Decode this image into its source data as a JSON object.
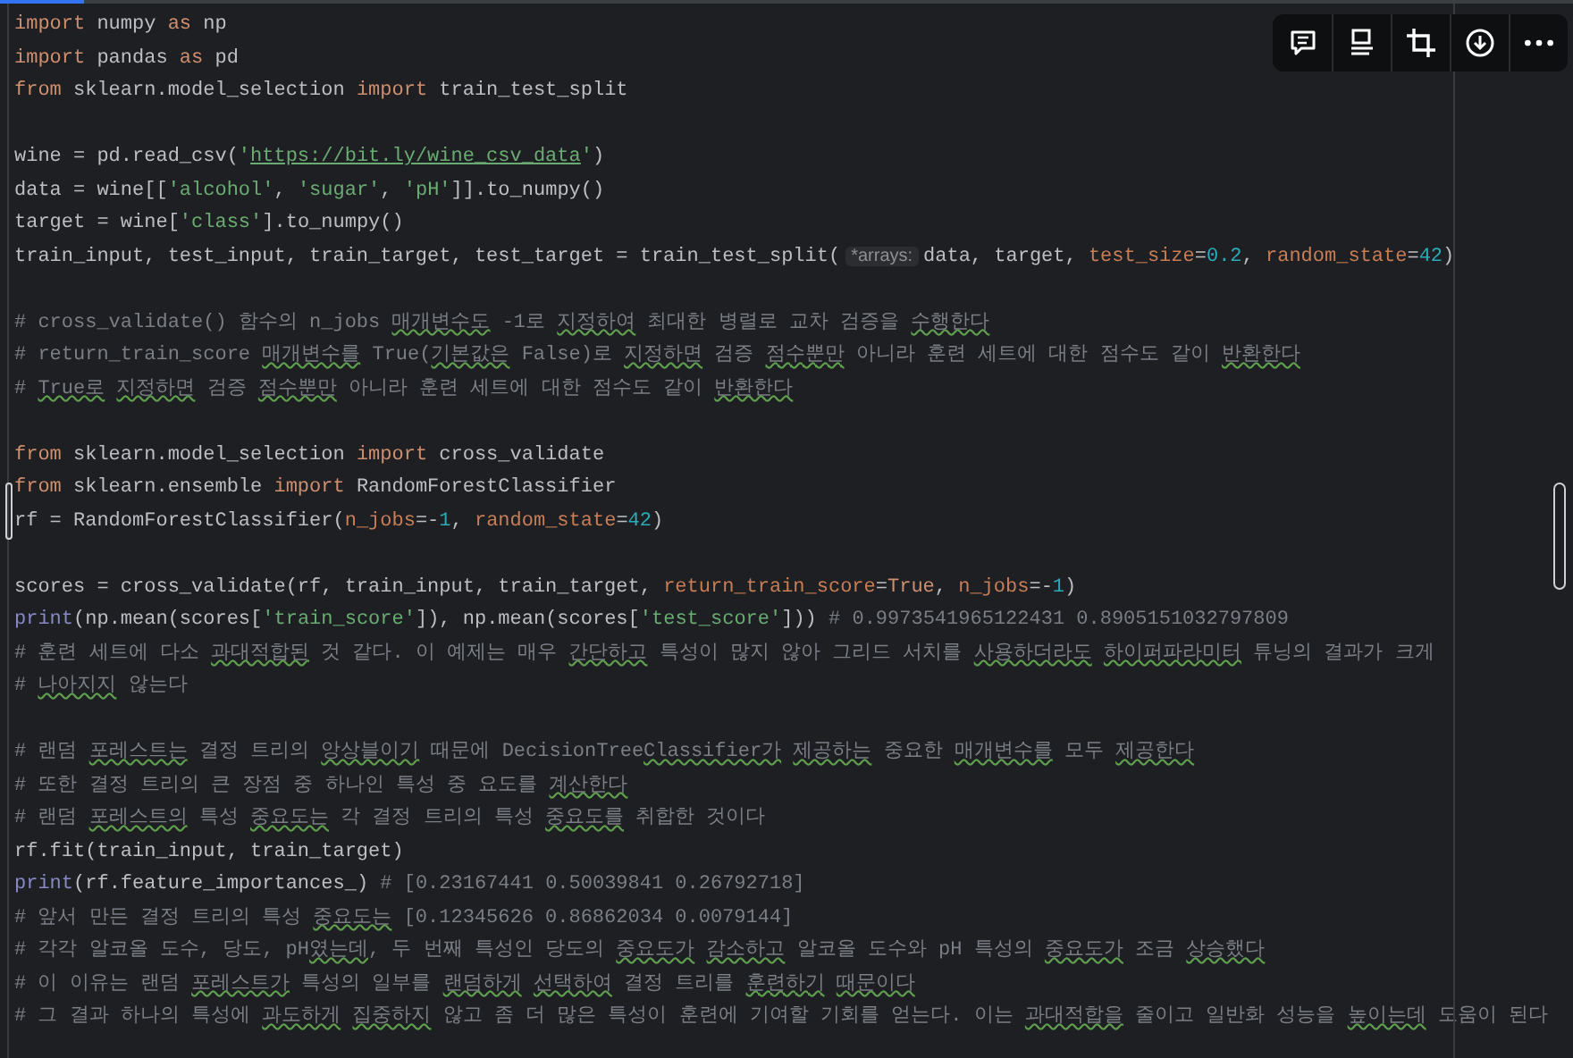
{
  "toolbar": {
    "buttons": [
      {
        "kind": "comment"
      },
      {
        "kind": "layout"
      },
      {
        "kind": "crop"
      },
      {
        "kind": "download"
      },
      {
        "kind": "more"
      }
    ]
  },
  "editor": {
    "lines": [
      {
        "kind": "code",
        "tokens": [
          {
            "kind": "kw",
            "text": "import"
          },
          {
            "kind": "plain",
            "text": " numpy "
          },
          {
            "kind": "kw",
            "text": "as"
          },
          {
            "kind": "plain",
            "text": " np"
          }
        ]
      },
      {
        "kind": "code",
        "tokens": [
          {
            "kind": "kw",
            "text": "import"
          },
          {
            "kind": "plain",
            "text": " pandas "
          },
          {
            "kind": "kw",
            "text": "as"
          },
          {
            "kind": "plain",
            "text": " pd"
          }
        ]
      },
      {
        "kind": "code",
        "tokens": [
          {
            "kind": "kw",
            "text": "from"
          },
          {
            "kind": "plain",
            "text": " sklearn.model_selection "
          },
          {
            "kind": "kw",
            "text": "import"
          },
          {
            "kind": "plain",
            "text": " train_test_split"
          }
        ]
      },
      {
        "kind": "blank"
      },
      {
        "kind": "code",
        "tokens": [
          {
            "kind": "plain",
            "text": "wine = pd.read_csv("
          },
          {
            "kind": "str",
            "text": "'"
          },
          {
            "kind": "link",
            "text": "https://bit.ly/wine_csv_data"
          },
          {
            "kind": "str",
            "text": "'"
          },
          {
            "kind": "plain",
            "text": ")"
          }
        ]
      },
      {
        "kind": "code",
        "tokens": [
          {
            "kind": "plain",
            "text": "data = wine[["
          },
          {
            "kind": "str",
            "text": "'alcohol'"
          },
          {
            "kind": "plain",
            "text": ", "
          },
          {
            "kind": "str",
            "text": "'sugar'"
          },
          {
            "kind": "plain",
            "text": ", "
          },
          {
            "kind": "str",
            "text": "'pH'"
          },
          {
            "kind": "plain",
            "text": "]].to_numpy()"
          }
        ]
      },
      {
        "kind": "code",
        "tokens": [
          {
            "kind": "plain",
            "text": "target = wine["
          },
          {
            "kind": "str",
            "text": "'class'"
          },
          {
            "kind": "plain",
            "text": "].to_numpy()"
          }
        ]
      },
      {
        "kind": "code",
        "tokens": [
          {
            "kind": "plain",
            "text": "train_input, test_input, train_target, test_target = train_test_split("
          },
          {
            "kind": "hint",
            "text": "*arrays:"
          },
          {
            "kind": "plain",
            "text": "data, target, "
          },
          {
            "kind": "param",
            "text": "test_size"
          },
          {
            "kind": "plain",
            "text": "="
          },
          {
            "kind": "num",
            "text": "0.2"
          },
          {
            "kind": "plain",
            "text": ", "
          },
          {
            "kind": "param",
            "text": "random_state"
          },
          {
            "kind": "plain",
            "text": "="
          },
          {
            "kind": "num",
            "text": "42"
          },
          {
            "kind": "plain",
            "text": ")"
          }
        ]
      },
      {
        "kind": "blank"
      },
      {
        "kind": "code",
        "tokens": [
          {
            "kind": "comment",
            "text": "# cross_validate() 함수의 n_jobs "
          },
          {
            "kind": "typo",
            "text": "매개변수도"
          },
          {
            "kind": "comment",
            "text": " -1로 "
          },
          {
            "kind": "typo",
            "text": "지정하여"
          },
          {
            "kind": "comment",
            "text": " 최대한 병렬로 교차 검증을 "
          },
          {
            "kind": "typo",
            "text": "수행한다"
          }
        ]
      },
      {
        "kind": "code",
        "tokens": [
          {
            "kind": "comment",
            "text": "# return_train_score "
          },
          {
            "kind": "typo",
            "text": "매개변수를"
          },
          {
            "kind": "comment",
            "text": " True("
          },
          {
            "kind": "typo",
            "text": "기본값은"
          },
          {
            "kind": "comment",
            "text": " False)로 "
          },
          {
            "kind": "typo",
            "text": "지정하면"
          },
          {
            "kind": "comment",
            "text": " 검증 "
          },
          {
            "kind": "typo",
            "text": "점수뿐만"
          },
          {
            "kind": "comment",
            "text": " 아니라 훈련 세트에 대한 점수도 같이 "
          },
          {
            "kind": "typo",
            "text": "반환한다"
          }
        ]
      },
      {
        "kind": "code",
        "tokens": [
          {
            "kind": "comment",
            "text": "# "
          },
          {
            "kind": "typo",
            "text": "True로",
            "space_after": true
          },
          {
            "kind": "typo",
            "text": "지정하면"
          },
          {
            "kind": "comment",
            "text": " 검증 "
          },
          {
            "kind": "typo",
            "text": "점수뿐만"
          },
          {
            "kind": "comment",
            "text": " 아니라 훈련 세트에 대한 점수도 같이 "
          },
          {
            "kind": "typo",
            "text": "반환한다"
          }
        ]
      },
      {
        "kind": "blank"
      },
      {
        "kind": "code",
        "tokens": [
          {
            "kind": "kw",
            "text": "from"
          },
          {
            "kind": "plain",
            "text": " sklearn.model_selection "
          },
          {
            "kind": "kw",
            "text": "import"
          },
          {
            "kind": "plain",
            "text": " cross_validate"
          }
        ]
      },
      {
        "kind": "code",
        "tokens": [
          {
            "kind": "kw",
            "text": "from"
          },
          {
            "kind": "plain",
            "text": " sklearn.ensemble "
          },
          {
            "kind": "kw",
            "text": "import"
          },
          {
            "kind": "plain",
            "text": " RandomForestClassifier"
          }
        ]
      },
      {
        "kind": "code",
        "tokens": [
          {
            "kind": "plain",
            "text": "rf = RandomForestClassifier("
          },
          {
            "kind": "param",
            "text": "n_jobs"
          },
          {
            "kind": "plain",
            "text": "=-"
          },
          {
            "kind": "num",
            "text": "1"
          },
          {
            "kind": "plain",
            "text": ", "
          },
          {
            "kind": "param",
            "text": "random_state"
          },
          {
            "kind": "plain",
            "text": "="
          },
          {
            "kind": "num",
            "text": "42"
          },
          {
            "kind": "plain",
            "text": ")"
          }
        ]
      },
      {
        "kind": "blank"
      },
      {
        "kind": "code",
        "tokens": [
          {
            "kind": "plain",
            "text": "scores = cross_validate(rf, train_input, train_target, "
          },
          {
            "kind": "param",
            "text": "return_train_score"
          },
          {
            "kind": "plain",
            "text": "="
          },
          {
            "kind": "kw",
            "text": "True"
          },
          {
            "kind": "plain",
            "text": ", "
          },
          {
            "kind": "param",
            "text": "n_jobs"
          },
          {
            "kind": "plain",
            "text": "=-"
          },
          {
            "kind": "num",
            "text": "1"
          },
          {
            "kind": "plain",
            "text": ")"
          }
        ]
      },
      {
        "kind": "code",
        "tokens": [
          {
            "kind": "builtin",
            "text": "print"
          },
          {
            "kind": "plain",
            "text": "(np.mean(scores["
          },
          {
            "kind": "str",
            "text": "'train_score'"
          },
          {
            "kind": "plain",
            "text": "]), np.mean(scores["
          },
          {
            "kind": "str",
            "text": "'test_score'"
          },
          {
            "kind": "plain",
            "text": "]))"
          },
          {
            "kind": "comment",
            "text": " # 0.9973541965122431 0.8905151032797809"
          }
        ]
      },
      {
        "kind": "code",
        "tokens": [
          {
            "kind": "comment",
            "text": "# 훈련 세트에 다소 "
          },
          {
            "kind": "typo",
            "text": "과대적합된"
          },
          {
            "kind": "comment",
            "text": " 것 같다. 이 예제는 매우 "
          },
          {
            "kind": "typo",
            "text": "간단하고"
          },
          {
            "kind": "comment",
            "text": " 특성이 많지 않아 그리드 서치를 "
          },
          {
            "kind": "typo",
            "text": "사용하더라도",
            "space_after": true
          },
          {
            "kind": "typo",
            "text": "하이퍼파라미터"
          },
          {
            "kind": "comment",
            "text": " 튜닝의 결과가 크게"
          }
        ]
      },
      {
        "kind": "code",
        "tokens": [
          {
            "kind": "comment",
            "text": "# "
          },
          {
            "kind": "typo",
            "text": "나아지지"
          },
          {
            "kind": "comment",
            "text": " 않는다"
          }
        ]
      },
      {
        "kind": "blank"
      },
      {
        "kind": "code",
        "tokens": [
          {
            "kind": "comment",
            "text": "# 랜덤 "
          },
          {
            "kind": "typo",
            "text": "포레스트는"
          },
          {
            "kind": "comment",
            "text": " 결정 트리의 "
          },
          {
            "kind": "typo",
            "text": "앙상블이기"
          },
          {
            "kind": "comment",
            "text": " 때문에 DecisionTree"
          },
          {
            "kind": "typo",
            "text": "Classifier가",
            "space_after": true
          },
          {
            "kind": "typo",
            "text": "제공하는"
          },
          {
            "kind": "comment",
            "text": " 중요한 "
          },
          {
            "kind": "typo",
            "text": "매개변수를"
          },
          {
            "kind": "comment",
            "text": " 모두 "
          },
          {
            "kind": "typo",
            "text": "제공한다"
          }
        ]
      },
      {
        "kind": "code",
        "tokens": [
          {
            "kind": "comment",
            "text": "# 또한 결정 트리의 큰 장점 중 하나인 특성 중 요도를 "
          },
          {
            "kind": "typo",
            "text": "계산한다"
          }
        ]
      },
      {
        "kind": "code",
        "tokens": [
          {
            "kind": "comment",
            "text": "# 랜덤 "
          },
          {
            "kind": "typo",
            "text": "포레스트의"
          },
          {
            "kind": "comment",
            "text": " 특성 "
          },
          {
            "kind": "typo",
            "text": "중요도는"
          },
          {
            "kind": "comment",
            "text": " 각 결정 트리의 특성 "
          },
          {
            "kind": "typo",
            "text": "중요도를"
          },
          {
            "kind": "comment",
            "text": " 취합한 것이다"
          }
        ]
      },
      {
        "kind": "code",
        "tokens": [
          {
            "kind": "plain",
            "text": "rf.fit(train_input, train_target)"
          }
        ]
      },
      {
        "kind": "code",
        "tokens": [
          {
            "kind": "builtin",
            "text": "print"
          },
          {
            "kind": "plain",
            "text": "(rf.feature_importances_)"
          },
          {
            "kind": "comment",
            "text": " # [0.23167441 0.50039841 0.26792718]"
          }
        ]
      },
      {
        "kind": "code",
        "tokens": [
          {
            "kind": "comment",
            "text": "# 앞서 만든 결정 트리의 특성 "
          },
          {
            "kind": "typo",
            "text": "중요도는"
          },
          {
            "kind": "comment",
            "text": " [0.12345626 0.86862034 0.0079144]"
          }
        ]
      },
      {
        "kind": "code",
        "tokens": [
          {
            "kind": "comment",
            "text": "# 각각 알코올 도수, 당도, pH"
          },
          {
            "kind": "typo",
            "text": "였는데"
          },
          {
            "kind": "comment",
            "text": ", 두 번째 특성인 당도의 "
          },
          {
            "kind": "typo",
            "text": "중요도가",
            "space_after": true
          },
          {
            "kind": "typo",
            "text": "감소하고"
          },
          {
            "kind": "comment",
            "text": " 알코올 도수와 pH 특성의 "
          },
          {
            "kind": "typo",
            "text": "중요도가"
          },
          {
            "kind": "comment",
            "text": " 조금 "
          },
          {
            "kind": "typo",
            "text": "상승했다"
          }
        ]
      },
      {
        "kind": "code",
        "tokens": [
          {
            "kind": "comment",
            "text": "# 이 이유는 랜덤 "
          },
          {
            "kind": "typo",
            "text": "포레스트가"
          },
          {
            "kind": "comment",
            "text": " 특성의 일부를 "
          },
          {
            "kind": "typo",
            "text": "랜덤하게",
            "space_after": true
          },
          {
            "kind": "typo",
            "text": "선택하여"
          },
          {
            "kind": "comment",
            "text": " 결정 트리를 "
          },
          {
            "kind": "typo",
            "text": "훈련하기",
            "space_after": true
          },
          {
            "kind": "typo",
            "text": "때문이다"
          }
        ]
      },
      {
        "kind": "code",
        "tokens": [
          {
            "kind": "comment",
            "text": "# 그 결과 하나의 특성에 "
          },
          {
            "kind": "typo",
            "text": "과도하게",
            "space_after": true
          },
          {
            "kind": "typo",
            "text": "집중하지"
          },
          {
            "kind": "comment",
            "text": " 않고 좀 더 많은 특성이 훈련에 기여할 기회를 얻는다. 이는 "
          },
          {
            "kind": "typo",
            "text": "과대적합을"
          },
          {
            "kind": "comment",
            "text": " 줄이고 일반화 성능을 "
          },
          {
            "kind": "typo",
            "text": "높이는데"
          },
          {
            "kind": "comment",
            "text": " 도움이 된다"
          }
        ]
      }
    ]
  }
}
